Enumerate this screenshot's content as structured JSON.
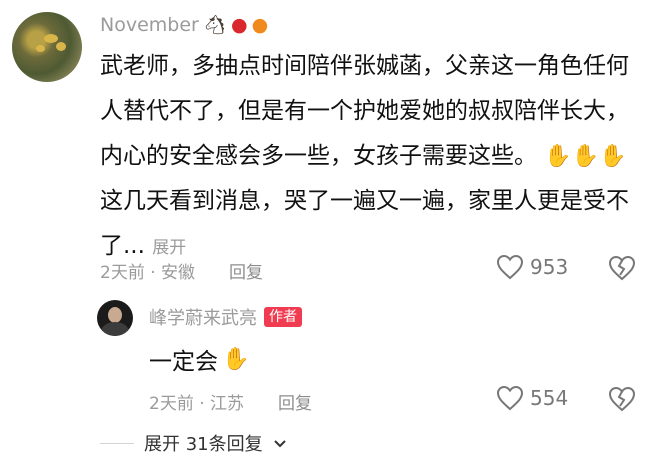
{
  "comment": {
    "username": "November",
    "badges": [
      "horse-emoji",
      "apple-emoji",
      "orange-emoji"
    ],
    "text_part1": "武老师，多抽点时间陪伴张娍菡，父亲这一角色任何人替代不了，但是有一个护她爱她的叔叔陪伴长大，内心的安全感会多一些，女孩子需要这些。",
    "text_part2": "这几天看到消息，哭了一遍又一遍，家里人更是受不了...",
    "expand_label": "展开",
    "meta": "2天前 · 安徽",
    "reply_label": "回复",
    "likes": "953"
  },
  "reply": {
    "username": "峰学蔚来武亮",
    "author_badge": "作者",
    "text": "一定会",
    "meta": "2天前 · 江苏",
    "reply_label": "回复",
    "likes": "554"
  },
  "expand_replies": "展开 31条回复",
  "colors": {
    "meta_gray": "#9b9b9b",
    "author_badge": "#f03b51",
    "emoji_gold": "#f2a21e"
  }
}
